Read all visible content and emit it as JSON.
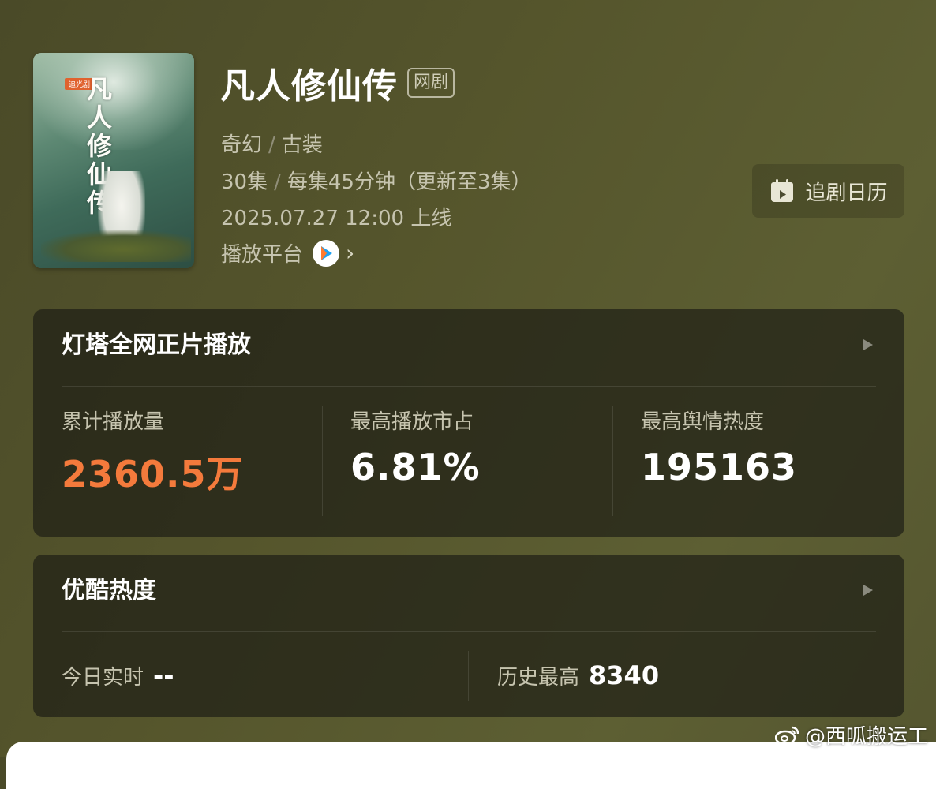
{
  "poster": {
    "calligraphy": "凡人修仙传",
    "tag": "追光剧"
  },
  "show": {
    "title": "凡人修仙传",
    "badge": "网剧",
    "genre_1": "奇幻",
    "genre_2": "古装",
    "episodes": "30集",
    "per_episode": "每集45分钟（更新至3集）",
    "release": "2025.07.27 12:00 上线",
    "platform_label": "播放平台",
    "separator": "/"
  },
  "calendar_button": {
    "label": "追剧日历",
    "icon": "calendar-icon"
  },
  "dengta_card": {
    "title": "灯塔全网正片播放",
    "stats": [
      {
        "label": "累计播放量",
        "value": "2360.5万"
      },
      {
        "label": "最高播放市占",
        "value": "6.81%"
      },
      {
        "label": "最高舆情热度",
        "value": "195163"
      }
    ]
  },
  "youku_card": {
    "title": "优酷热度",
    "today_label": "今日实时",
    "today_value": "--",
    "history_label": "历史最高",
    "history_value": "8340"
  },
  "watermark": {
    "text": "@西呱搬运工",
    "icon": "weibo-icon"
  },
  "colors": {
    "accent_orange": "#f47a3c",
    "background": "#55552c"
  }
}
